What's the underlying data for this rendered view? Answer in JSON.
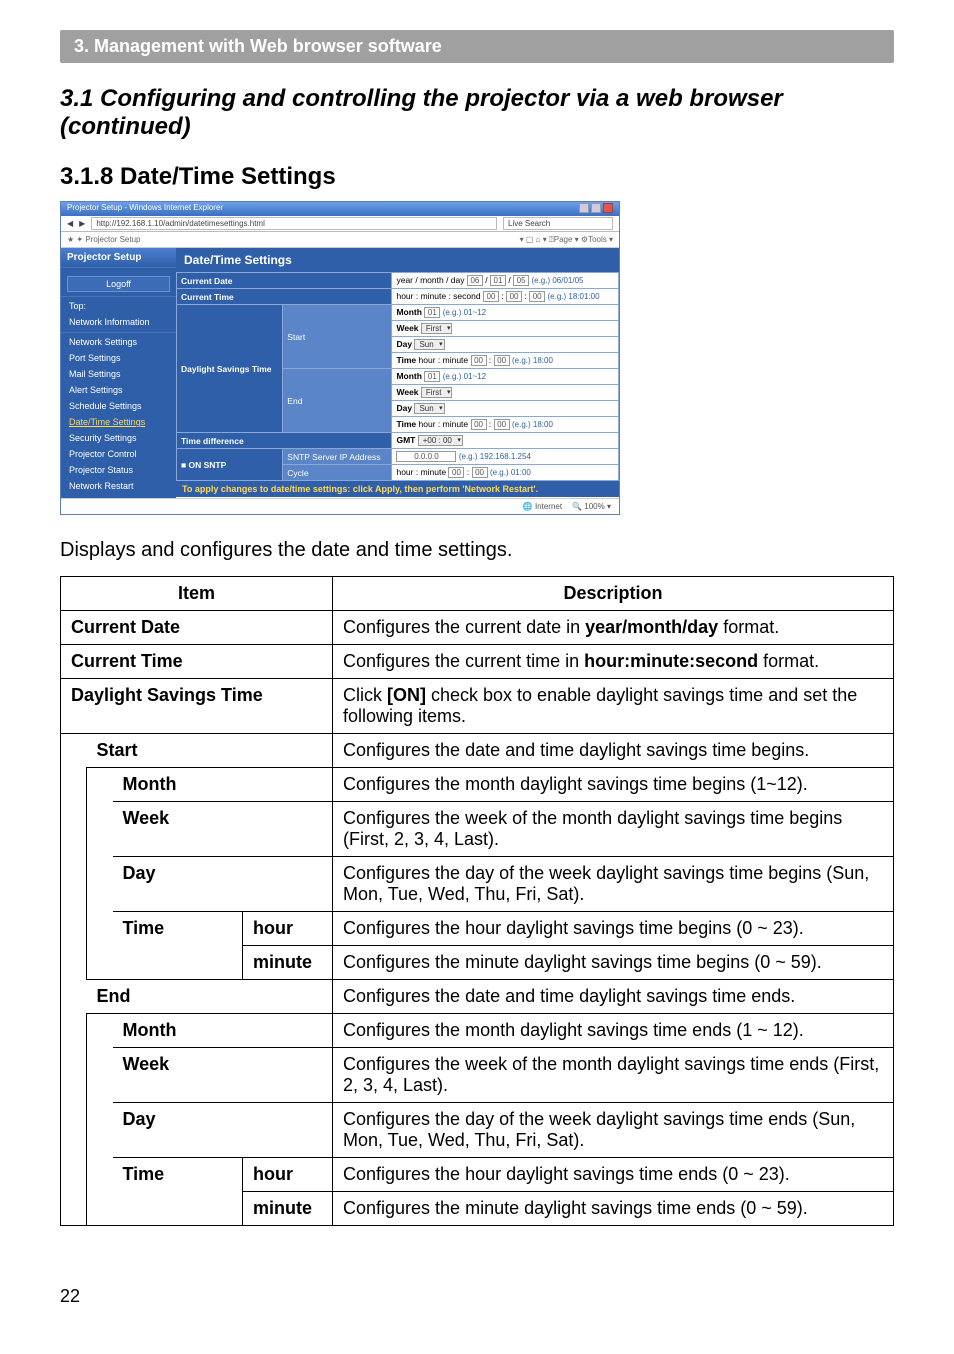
{
  "banner": "3. Management with Web browser software",
  "h_main": "3.1 Configuring and controlling the projector via a web browser (continued)",
  "h_sub": "3.1.8 Date/Time Settings",
  "intro": "Displays and configures the date and time settings.",
  "headers": {
    "item": "Item",
    "desc": "Description"
  },
  "rows": {
    "current_date": {
      "item": "Current Date",
      "desc_a": "Configures the current date in ",
      "bold": "year/month/day",
      "desc_b": " format."
    },
    "current_time": {
      "item": "Current Time",
      "desc_a": "Configures the current time in ",
      "bold": "hour:minute:second",
      "desc_b": " format."
    },
    "dst": {
      "item": "Daylight Savings Time",
      "desc_a": "Click ",
      "bold": "[ON]",
      "desc_b": " check box to enable daylight savings time and set the following items."
    },
    "start": {
      "item": "Start",
      "desc": "Configures the date and time daylight savings time begins."
    },
    "s_month": {
      "item": "Month",
      "desc": "Configures the month daylight savings time begins (1~12)."
    },
    "s_week": {
      "item": "Week",
      "desc": "Configures the week of the month daylight savings time begins (First, 2, 3, 4, Last)."
    },
    "s_day": {
      "item": "Day",
      "desc": "Configures the day of the week daylight savings time begins (Sun, Mon, Tue, Wed, Thu, Fri, Sat)."
    },
    "s_time": {
      "item": "Time"
    },
    "s_hour": {
      "item": "hour",
      "desc": "Configures the hour daylight savings time begins (0 ~ 23)."
    },
    "s_min": {
      "item": "minute",
      "desc": "Configures the minute daylight savings time begins (0 ~ 59)."
    },
    "end": {
      "item": "End",
      "desc": "Configures the date and time daylight savings time ends."
    },
    "e_month": {
      "item": "Month",
      "desc": "Configures the month daylight savings time ends (1 ~ 12)."
    },
    "e_week": {
      "item": "Week",
      "desc": "Configures the week of the month daylight savings time ends (First, 2, 3, 4, Last)."
    },
    "e_day": {
      "item": "Day",
      "desc": "Configures the day of the week daylight savings time ends (Sun, Mon, Tue, Wed, Thu, Fri, Sat)."
    },
    "e_time": {
      "item": "Time"
    },
    "e_hour": {
      "item": "hour",
      "desc": "Configures the hour daylight savings time ends (0 ~ 23)."
    },
    "e_min": {
      "item": "minute",
      "desc": "Configures the minute daylight savings time ends (0 ~ 59)."
    }
  },
  "page_no": "22",
  "ss": {
    "win_title": "Projector Setup - Windows Internet Explorer",
    "url": "http://192.168.1.10/admin/datetimesettings.html",
    "search": "Live Search",
    "fav": "Projector Setup",
    "tools": "▾ ▢  ⌂ ▾ ⍰Page ▾ ⚙Tools ▾",
    "brand": "Projector Setup",
    "nav": {
      "logoff": "Logoff",
      "top": "Top:",
      "netinfo": "Network Information",
      "netset": "Network Settings",
      "port": "Port Settings",
      "mail": "Mail Settings",
      "alert": "Alert Settings",
      "sched": "Schedule Settings",
      "dt": "Date/Time Settings",
      "sec": "Security Settings",
      "pctrl": "Projector Control",
      "pstat": "Projector Status",
      "nrestart": "Network Restart"
    },
    "panel_title": "Date/Time Settings",
    "labels": {
      "cur_date": "Current Date",
      "cur_time": "Current Time",
      "dst": "Daylight Savings Time",
      "start": "Start",
      "end": "End",
      "month": "Month",
      "week": "Week",
      "day": "Day",
      "time": "Time",
      "timediff": "Time difference",
      "sntp": "SNTP",
      "sntp_ip": "SNTP Server IP Address",
      "cycle": "Cycle",
      "on": "■ ON"
    },
    "vals": {
      "date_hint": "year / month / day",
      "date_eg": "(e.g.) 06/01/05",
      "time_hint": "hour : minute : second",
      "time_eg": "(e.g.) 18:01:00",
      "month_v": "01",
      "month_eg": "(e.g.) 01~12",
      "week_v": "First",
      "day_v": "Sun",
      "hm_hint": "hour : minute",
      "hm_eg": "(e.g.) 18:00",
      "gmt": "GMT",
      "gmt_v": "+00 : 00",
      "ip_v": "0.0.0.0",
      "ip_eg": "(e.g.) 192.168.1.254",
      "cycle_eg": "(e.g.) 01:00"
    },
    "apply": "To apply changes to date/time settings: click Apply, then perform 'Network Restart'.",
    "status_a": "Internet",
    "status_b": "100%"
  }
}
